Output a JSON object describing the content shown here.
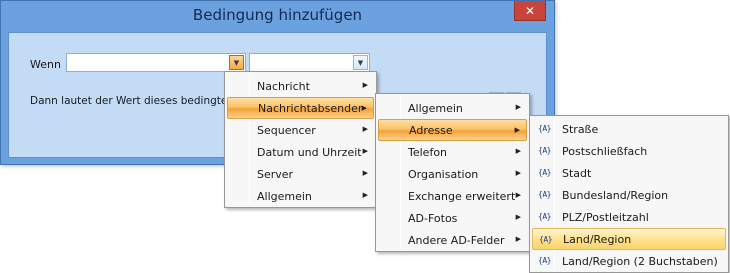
{
  "dialog": {
    "title": "Bedingung hinzufügen",
    "close_glyph": "✕",
    "wenn_label": "Wenn",
    "combo1_value": "",
    "combo2_value": "",
    "dann_label": "Dann lautet der Wert dieses bedingten Feldes"
  },
  "menu1": {
    "items": [
      {
        "label": "Nachricht",
        "submenu": true,
        "highlighted": false
      },
      {
        "label": "Nachrichtabsender",
        "submenu": true,
        "highlighted": true
      },
      {
        "label": "Sequencer",
        "submenu": true,
        "highlighted": false
      },
      {
        "label": "Datum und Uhrzeit",
        "submenu": true,
        "highlighted": false
      },
      {
        "label": "Server",
        "submenu": true,
        "highlighted": false
      },
      {
        "label": "Allgemein",
        "submenu": true,
        "highlighted": false
      }
    ]
  },
  "menu2": {
    "items": [
      {
        "label": "Allgemein",
        "submenu": true,
        "highlighted": false
      },
      {
        "label": "Adresse",
        "submenu": true,
        "highlighted": true
      },
      {
        "label": "Telefon",
        "submenu": true,
        "highlighted": false
      },
      {
        "label": "Organisation",
        "submenu": true,
        "highlighted": false
      },
      {
        "label": "Exchange erweitert",
        "submenu": true,
        "highlighted": false
      },
      {
        "label": "AD-Fotos",
        "submenu": true,
        "highlighted": false
      },
      {
        "label": "Andere AD-Felder",
        "submenu": true,
        "highlighted": false
      }
    ]
  },
  "menu3": {
    "icon_glyph": "{A}",
    "items": [
      {
        "label": "Straße",
        "highlighted": false
      },
      {
        "label": "Postschließfach",
        "highlighted": false
      },
      {
        "label": "Stadt",
        "highlighted": false
      },
      {
        "label": "Bundesland/Region",
        "highlighted": false
      },
      {
        "label": "PLZ/Postleitzahl",
        "highlighted": false
      },
      {
        "label": "Land/Region",
        "highlighted": true
      },
      {
        "label": "Land/Region (2 Buchstaben)",
        "highlighted": false
      }
    ]
  },
  "colors": {
    "window_frame": "#6ba1de",
    "client_area": "#c4dbf5",
    "close_button": "#c7453c",
    "menu_highlight": "#f5a13a"
  }
}
